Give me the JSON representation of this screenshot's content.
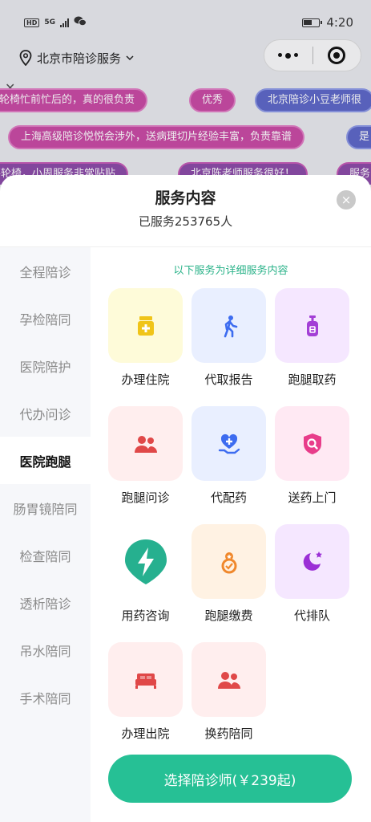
{
  "status_bar": {
    "time": "4:20",
    "hd": "HD",
    "net": "5G"
  },
  "header": {
    "location": "北京市陪诊服务"
  },
  "barrage": [
    "推轮椅忙前忙后的，真的很负责",
    "优秀",
    "北京陪诊小豆老师很",
    "上海高级陪诊悦悦会涉外，送病理切片经验丰富，负责靠谱",
    "是",
    "要轮椅，小周服务非常贴贴",
    "北京陈老师服务很好！",
    "服务"
  ],
  "sheet": {
    "title": "服务内容",
    "served_count": "已服务253765人",
    "close_icon": "×",
    "hint": "以下服务为详细服务内容",
    "cta": "选择陪诊师(￥239起)"
  },
  "sidebar": {
    "items": [
      "全程陪诊",
      "孕检陪同",
      "医院陪护",
      "代办问诊",
      "医院跑腿",
      "肠胃镜陪同",
      "检查陪同",
      "透析陪诊",
      "吊水陪同",
      "手术陪同"
    ],
    "active_index": 4
  },
  "services": [
    {
      "label": "办理住院",
      "icon": "medicine-bottle-icon",
      "bg": "#fefbd9",
      "fg": "#f0c419"
    },
    {
      "label": "代取报告",
      "icon": "walking-person-icon",
      "bg": "#e9efff",
      "fg": "#3d6cf0"
    },
    {
      "label": "跑腿取药",
      "icon": "pump-bottle-icon",
      "bg": "#f5e7ff",
      "fg": "#a33fd6"
    },
    {
      "label": "跑腿问诊",
      "icon": "users-icon",
      "bg": "#ffeeee",
      "fg": "#e04848"
    },
    {
      "label": "代配药",
      "icon": "heart-hand-icon",
      "bg": "#e9efff",
      "fg": "#3d6cf0"
    },
    {
      "label": "送药上门",
      "icon": "shield-search-icon",
      "bg": "#ffe9f3",
      "fg": "#e83d8a"
    },
    {
      "label": "用药咨询",
      "icon": "lightning-icon",
      "bg": "#ffffff",
      "fg": "#26b08f"
    },
    {
      "label": "跑腿缴费",
      "icon": "medal-icon",
      "bg": "#fff2e3",
      "fg": "#f0882c"
    },
    {
      "label": "代排队",
      "icon": "moon-star-icon",
      "bg": "#f5e7ff",
      "fg": "#9b2fd6"
    },
    {
      "label": "办理出院",
      "icon": "bed-icon",
      "bg": "#ffeeee",
      "fg": "#e04848"
    },
    {
      "label": "换药陪同",
      "icon": "users-icon",
      "bg": "#ffeeee",
      "fg": "#e04848"
    }
  ]
}
